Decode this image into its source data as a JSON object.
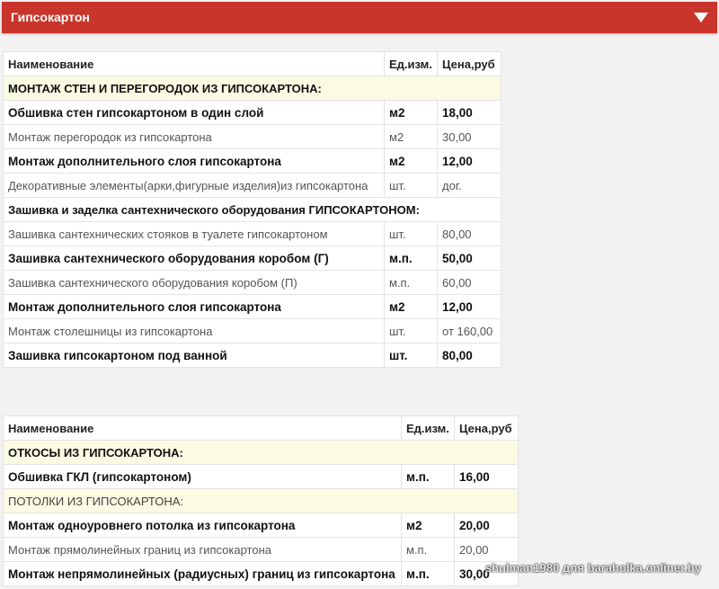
{
  "header": {
    "title": "Гипсокартон"
  },
  "table1": {
    "columns": [
      "Наименование",
      "Ед.изм.",
      "Цена,руб"
    ],
    "rows": [
      {
        "name": "МОНТАЖ СТЕН И ПЕРЕГОРОДОК ИЗ ГИПСОКАРТОНА:",
        "unit": "",
        "price": ""
      },
      {
        "name": "Обшивка стен гипсокартоном в один слой",
        "unit": "м2",
        "price": "18,00"
      },
      {
        "name": "Монтаж перегородок из гипсокартона",
        "unit": "м2",
        "price": "30,00"
      },
      {
        "name": "Монтаж дополнительного слоя гипсокартона",
        "unit": "м2",
        "price": "12,00"
      },
      {
        "name": "Декоративные элементы(арки,фигурные изделия)из гипсокартона",
        "unit": "шт.",
        "price": "дог."
      },
      {
        "name": "Зашивка  и заделка сантехнического оборудования ГИПСОКАРТОНОМ:",
        "unit": "",
        "price": ""
      },
      {
        "name": "Зашивка сантехнических стояков в туалете гипсокартоном",
        "unit": "шт.",
        "price": "80,00"
      },
      {
        "name": "Зашивка сантехнического оборудования коробом (Г)",
        "unit": "м.п.",
        "price": "50,00"
      },
      {
        "name": "Зашивка сантехнического оборудования коробом (П)",
        "unit": "м.п.",
        "price": "60,00"
      },
      {
        "name": "Монтаж дополнительного слоя гипсокартона",
        "unit": "м2",
        "price": "12,00"
      },
      {
        "name": "Монтаж столешницы из гипсокартона",
        "unit": "шт.",
        "price": "от 160,00"
      },
      {
        "name": "Зашивка гипсокартоном под ванной",
        "unit": "шт.",
        "price": "80,00"
      }
    ]
  },
  "table2": {
    "columns": [
      "Наименование",
      "Ед.изм.",
      "Цена,руб"
    ],
    "rows": [
      {
        "name": "ОТКОСЫ ИЗ ГИПСОКАРТОНА:",
        "unit": "",
        "price": ""
      },
      {
        "name": "Обшивка ГКЛ (гипсокартоном)",
        "unit": "м.п.",
        "price": "16,00"
      },
      {
        "name": "ПОТОЛКИ ИЗ ГИПСОКАРТОНА:",
        "unit": "",
        "price": ""
      },
      {
        "name": "Монтаж одноуровнего потолка из гипсокартона",
        "unit": "м2",
        "price": "20,00"
      },
      {
        "name": "Монтаж прямолинейных  границ из гипсокартона",
        "unit": "м.п.",
        "price": "20,00"
      },
      {
        "name": "Монтаж непрямолинейных (радиусных)  границ из гипсокартона",
        "unit": "м.п.",
        "price": "30,00"
      }
    ]
  },
  "watermark": "shulman1980 для baraholka.onliner.by"
}
